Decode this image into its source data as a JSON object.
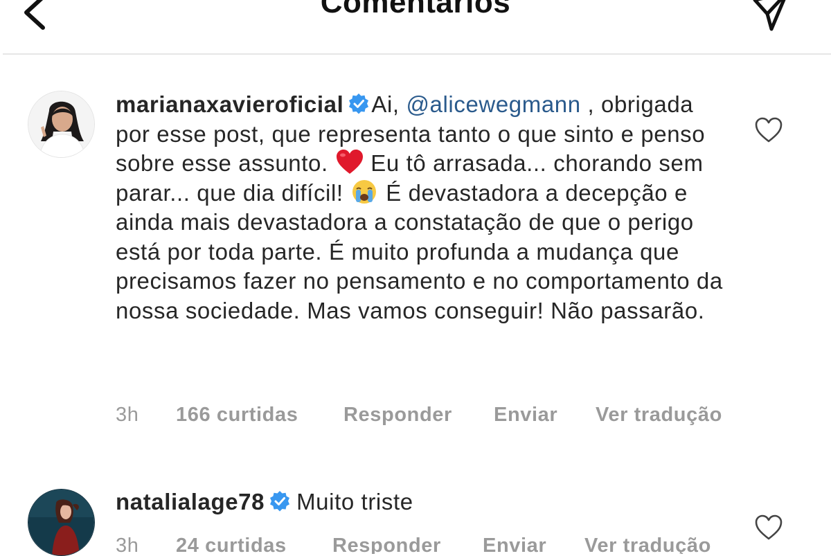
{
  "header": {
    "title": "Comentários"
  },
  "comments": [
    {
      "username": "marianaxavieroficial",
      "verified": true,
      "text_before_mention": "Ai, ",
      "mention": "@alicewegmann",
      "text_after_mention": " , obrigada por esse post,  que representa tanto o que sinto e penso sobre esse assunto. ",
      "emoji_1": "heart-emoji",
      "text_middle": " Eu tô arrasada... chorando sem parar... que dia difícil! ",
      "emoji_2": "crying-face-emoji",
      "text_end": " É devastadora a decepção e ainda mais devastadora a constatação de que o perigo está por toda parte. É muito profunda a mudança que precisamos fazer no pensamento e no comportamento da nossa sociedade. Mas vamos conseguir! Não passarão.",
      "time": "3h",
      "likes": "166 curtidas",
      "reply": "Responder",
      "send": "Enviar",
      "translate": "Ver tradução"
    },
    {
      "username": "natalialage78",
      "verified": true,
      "text": "Muito triste",
      "time": "3h",
      "likes": "24 curtidas",
      "reply": "Responder",
      "send": "Enviar",
      "translate": "Ver tradução"
    }
  ],
  "colors": {
    "text": "#262626",
    "meta": "#9a9a9a",
    "mention": "#2a5a8c",
    "verified": "#3897f0",
    "divider": "#e6e6e6",
    "heart": "#e0192c"
  },
  "icons": {
    "back": "chevron-left-icon",
    "send": "paper-plane-icon",
    "verified": "verified-badge-icon",
    "like": "heart-outline-icon"
  }
}
